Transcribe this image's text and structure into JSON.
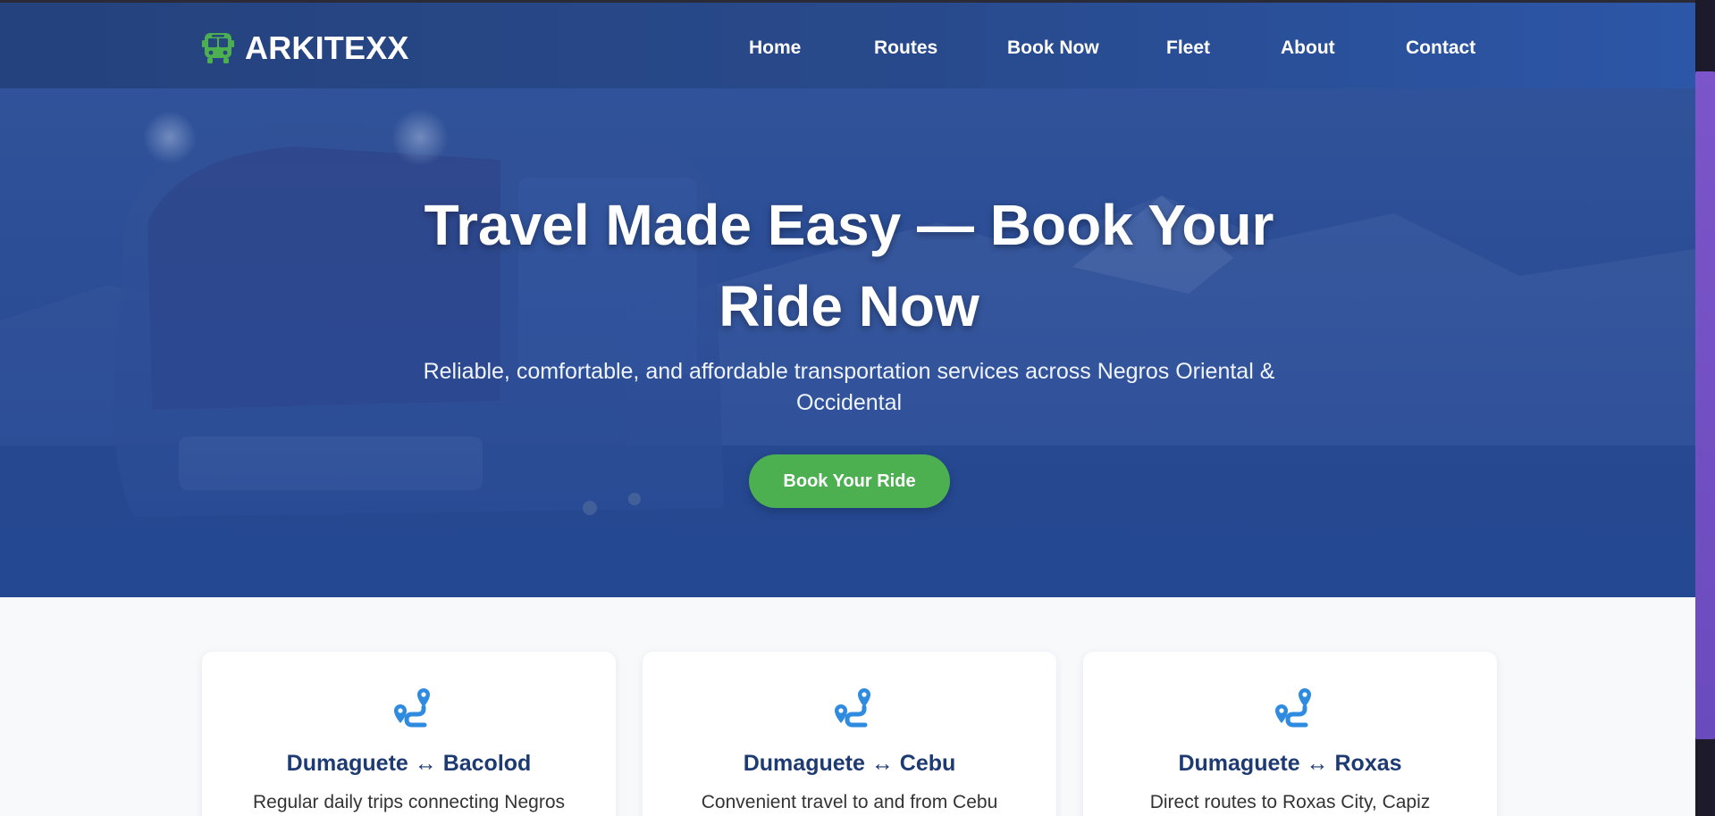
{
  "brand": {
    "name": "ARKITEXX",
    "icon": "bus-icon",
    "icon_color": "#4caf50"
  },
  "nav": {
    "items": [
      {
        "label": "Home"
      },
      {
        "label": "Routes"
      },
      {
        "label": "Book Now"
      },
      {
        "label": "Fleet"
      },
      {
        "label": "About"
      },
      {
        "label": "Contact"
      }
    ]
  },
  "hero": {
    "title": "Travel Made Easy — Book Your Ride Now",
    "subtitle": "Reliable, comfortable, and affordable transportation services across Negros Oriental & Occidental",
    "cta_label": "Book Your Ride",
    "cta_color": "#4caf50",
    "overlay_color": "#2b4f9c",
    "background": "bus-at-night-photo"
  },
  "routes": {
    "icon": "route-icon",
    "icon_color": "#2f8be0",
    "cards": [
      {
        "title": "Dumaguete ↔ Bacolod",
        "desc": "Regular daily trips connecting Negros"
      },
      {
        "title": "Dumaguete ↔ Cebu",
        "desc": "Convenient travel to and from Cebu"
      },
      {
        "title": "Dumaguete ↔ Roxas",
        "desc": "Direct routes to Roxas City, Capiz"
      }
    ]
  },
  "colors": {
    "nav_bg": "#28498a",
    "card_title": "#1e3a73",
    "page_bg": "#f7f9fb",
    "scrollbar_thumb": "#7b55c9"
  }
}
